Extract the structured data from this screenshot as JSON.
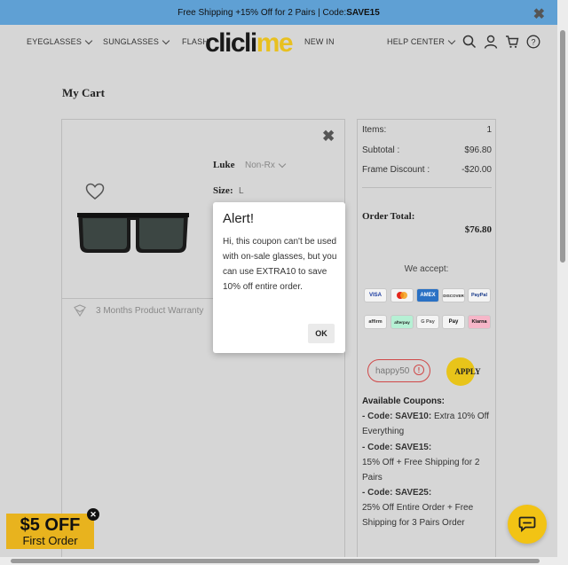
{
  "promo": {
    "text_prefix": "Free Shipping +15% Off for 2 Pairs | Code: ",
    "code": "SAVE15"
  },
  "nav": {
    "eyeglasses": "EYEGLASSES",
    "sunglasses": "SUNGLASSES",
    "flash": "FLASH",
    "new_in": "NEW IN",
    "help_center": "HELP CENTER",
    "logo_part1": "clicli",
    "logo_part2": "me"
  },
  "page": {
    "title": "My Cart"
  },
  "item": {
    "name": "Luke",
    "rx": "Non-Rx",
    "size_label": "Size:",
    "size_value": "L",
    "warranty": "3 Months Product Warranty"
  },
  "summary": {
    "items_label": "Items:",
    "items_value": "1",
    "subtotal_label": "Subtotal :",
    "subtotal_value": "$96.80",
    "discount_label": "Frame Discount :",
    "discount_value": "-$20.00",
    "total_label": "Order Total:",
    "total_value": "$76.80",
    "accept_label": "We accept:",
    "payments": [
      "VISA",
      "MC",
      "AMEX",
      "DISCOVER",
      "PayPal",
      "affirm",
      "afterpay",
      "G Pay",
      "Pay",
      "Klarna"
    ],
    "coupon_value": "happy50",
    "apply_label": "APPLY",
    "available_title": "Available Coupons:",
    "coupons": [
      {
        "code": " - Code: SAVE10:",
        "desc": " Extra 10% Off Everything"
      },
      {
        "code": " - Code: SAVE15:",
        "desc": "15% Off + Free Shipping for 2 Pairs"
      },
      {
        "code": " - Code: SAVE25:",
        "desc": "25% Off Entire Order + Free Shipping for 3 Pairs Order"
      }
    ]
  },
  "alert": {
    "title": "Alert!",
    "message": "Hi, this coupon can't be used with on-sale glasses, but you can use EXTRA10 to save 10% off entire order.",
    "ok": "OK"
  },
  "first_order": {
    "amount": "$5 OFF",
    "label": "First Order"
  },
  "colors": {
    "promo_bar": "#5fa0d4",
    "accent_yellow": "#e8c41a",
    "error_red": "#d04848"
  }
}
